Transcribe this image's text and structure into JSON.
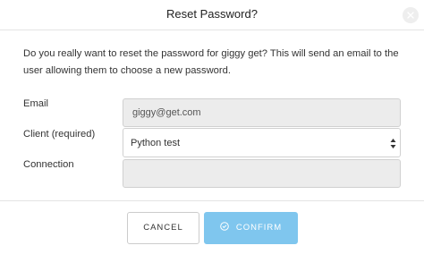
{
  "dialog": {
    "title": "Reset Password?",
    "description": "Do you really want to reset the password for giggy get? This will send an email to the user allowing them to choose a new password.",
    "close_icon": "close-icon"
  },
  "form": {
    "email_label": "Email",
    "email_value": "giggy@get.com",
    "client_label": "Client (required)",
    "client_selected": "Python test",
    "connection_label": "Connection",
    "connection_value": ""
  },
  "actions": {
    "cancel_label": "CANCEL",
    "confirm_label": "CONFIRM",
    "confirm_icon": "check-circle-icon"
  },
  "colors": {
    "confirm_button": "#7fc6ee",
    "disabled_field": "#ececec"
  }
}
